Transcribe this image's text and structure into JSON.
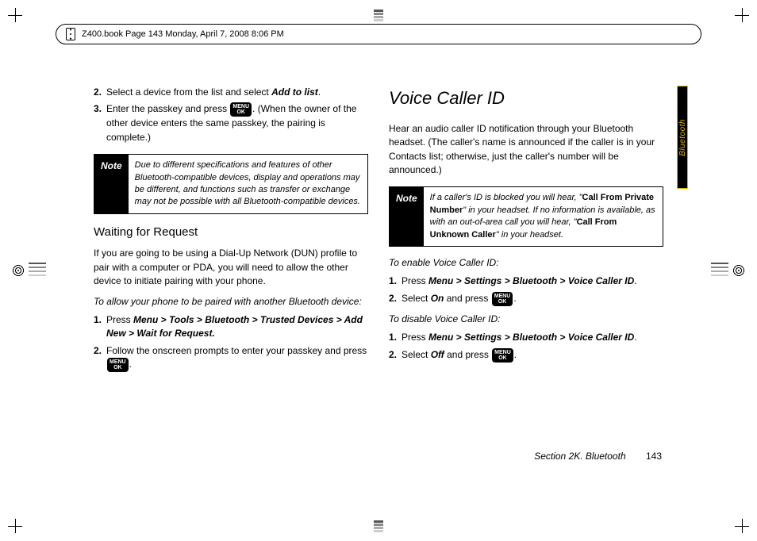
{
  "header": {
    "text": "Z400.book  Page 143  Monday, April 7, 2008  8:06 PM"
  },
  "sideTab": {
    "label": "Bluetooth"
  },
  "key": {
    "top": "MENU",
    "bottom": "OK"
  },
  "left": {
    "list1": {
      "n2": "2.",
      "t2a": "Select a device from the list and select ",
      "t2b": "Add to list",
      "t2c": ".",
      "n3": "3.",
      "t3a": "Enter the passkey and press ",
      "t3b": ". (When the owner of the other device enters the same passkey, the pairing is complete.)"
    },
    "note": {
      "label": "Note",
      "body": "Due to different specifications and features of other Bluetooth-compatible devices, display and operations may be different, and functions such as transfer or exchange may not be possible with all Bluetooth-compatible devices."
    },
    "h1": "Waiting for Request",
    "p1": "If you are going to be using a Dial-Up Network (DUN) profile to pair with a computer or PDA, you will need to allow the other device to initiate pairing with your phone.",
    "p2": "To allow your phone to be paired with another Bluetooth device:",
    "list2": {
      "n1": "1.",
      "t1a": "Press ",
      "t1b": "Menu > Tools > Bluetooth > Trusted Devices > Add New > Wait for Request.",
      "n2": "2.",
      "t2a": "Follow the onscreen prompts to enter your passkey and press ",
      "t2b": "."
    }
  },
  "right": {
    "h1": "Voice Caller ID",
    "p1": "Hear an audio caller ID notification through your Bluetooth headset. (The caller's name is announced if the caller is in your Contacts list; otherwise, just the caller's number will be announced.)",
    "note": {
      "label": "Note",
      "b1": "If a caller's ID is blocked you will hear, \"",
      "b2": "Call From Private Number",
      "b3": "\" in your headset. If no information is available, as with an out-of-area call you will hear, \"",
      "b4": "Call From Unknown Caller",
      "b5": "\" in your headset."
    },
    "p2": "To enable Voice Caller ID:",
    "list1": {
      "n1": "1.",
      "t1a": "Press ",
      "t1b": "Menu > Settings > Bluetooth > Voice Caller ID",
      "t1c": ".",
      "n2": "2.",
      "t2a": "Select ",
      "t2b": "On",
      "t2c": " and press ",
      "t2d": "."
    },
    "p3": "To disable Voice Caller ID:",
    "list2": {
      "n1": "1.",
      "t1a": "Press ",
      "t1b": "Menu > Settings > Bluetooth > Voice Caller ID",
      "t1c": ".",
      "n2": "2.",
      "t2a": "Select ",
      "t2b": "Off",
      "t2c": " and press ",
      "t2d": "."
    }
  },
  "footer": {
    "section": "Section 2K. Bluetooth",
    "page": "143"
  }
}
